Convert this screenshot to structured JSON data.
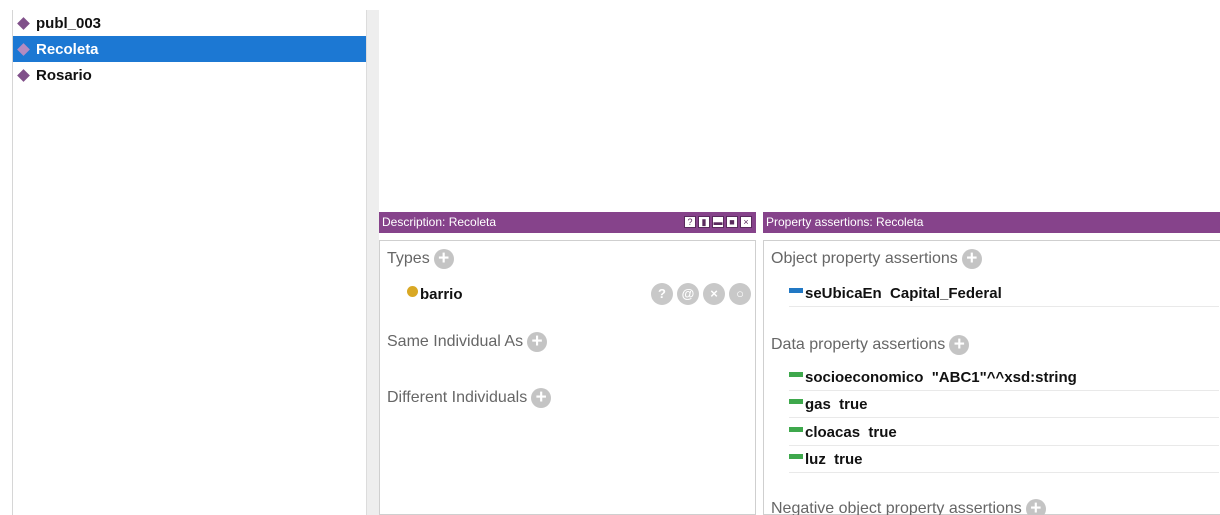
{
  "individuals": [
    {
      "label": "publ_003",
      "selected": false
    },
    {
      "label": "Recoleta",
      "selected": true
    },
    {
      "label": "Rosario",
      "selected": false
    }
  ],
  "description_panel": {
    "title": "Description: Recoleta",
    "types_label": "Types",
    "type_value": "barrio",
    "same_individual_label": "Same Individual As",
    "different_individuals_label": "Different Individuals"
  },
  "property_panel": {
    "title": "Property assertions: Recoleta",
    "object_label": "Object property assertions",
    "object_items": [
      "seUbicaEn  Capital_Federal"
    ],
    "data_label": "Data property assertions",
    "data_items": [
      "socioeconomico  \"ABC1\"^^xsd:string",
      "gas  true",
      "cloacas  true",
      "luz  true"
    ],
    "negative_label": "Negative object property assertions"
  },
  "colors": {
    "header": "#86438b",
    "selection": "#1c78d3",
    "object_property": "#2178c4",
    "data_property": "#3ea84c",
    "class": "#d9a824"
  },
  "icons": {
    "row_buttons": [
      "help-icon",
      "annotate-icon",
      "delete-icon",
      "edit-icon"
    ],
    "add": "plus-icon"
  }
}
